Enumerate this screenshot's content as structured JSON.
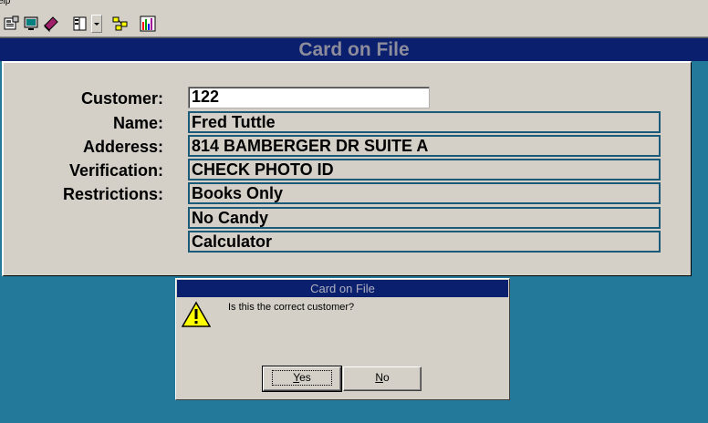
{
  "menu": {
    "help_label": "elp"
  },
  "toolbar": {
    "buttons": [
      "properties-icon",
      "monitor-icon",
      "book-icon",
      "layout-icon",
      "network-icon",
      "bar-chart-icon"
    ]
  },
  "window": {
    "title": "Card on File"
  },
  "form": {
    "customer_label": "Customer:",
    "customer_value": "122",
    "name_label": "Name:",
    "name_value": "Fred Tuttle",
    "address_label": "Adderess:",
    "address_value": "814 BAMBERGER DR SUITE A",
    "verification_label": "Verification:",
    "verification_value": "CHECK PHOTO ID",
    "restrictions_label": "Restrictions:",
    "restrictions": [
      "Books Only",
      "No Candy",
      "Calculator"
    ]
  },
  "dialog": {
    "title": "Card on File",
    "message": "Is this the correct customer?",
    "yes_mnemonic": "Y",
    "yes_rest": "es",
    "no_mnemonic": "N",
    "no_rest": "o"
  },
  "colors": {
    "desktop": "#23799a",
    "title_bar": "#0a1f6e",
    "panel": "#d4d0c8",
    "field_border": "#1b5a78"
  }
}
